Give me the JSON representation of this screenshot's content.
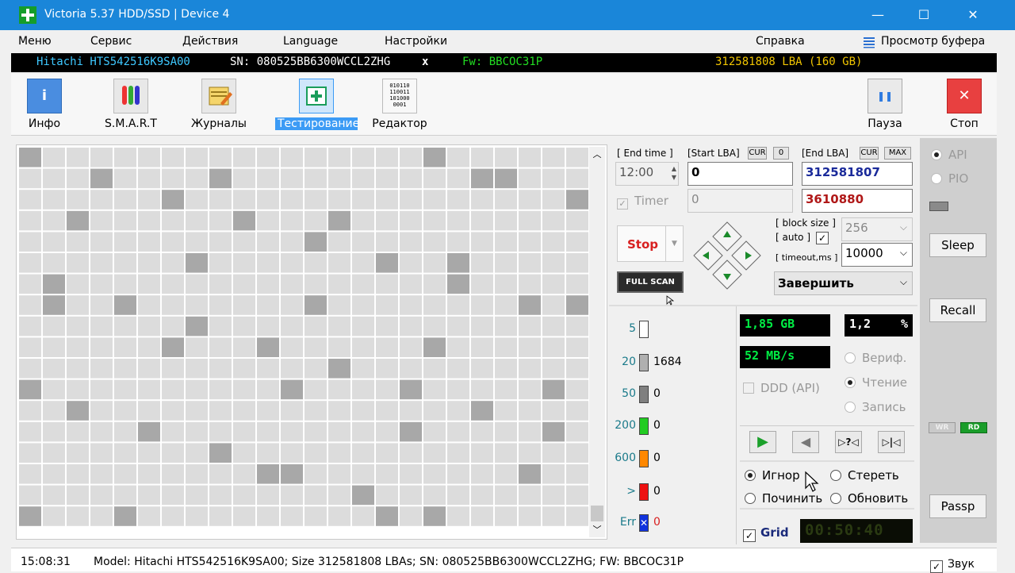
{
  "window": {
    "title": "Victoria 5.37 HDD/SSD | Device 4",
    "minimize": "—",
    "maximize": "☐",
    "close": "✕"
  },
  "menu": [
    "Меню",
    "Сервис",
    "Действия",
    "Language",
    "Настройки"
  ],
  "menu_right": {
    "help": "Справка",
    "buffer_icon": "list-icon",
    "buffer": "Просмотр буфера"
  },
  "device": {
    "model": "Hitachi HTS542516K9SA00",
    "sn": "SN: 080525BB6300WCCL2ZHG",
    "close": "x",
    "fw": "Fw: BBCOC31P",
    "lba": "312581808 LBA (160 GB)"
  },
  "toolbar": {
    "info": "Инфо",
    "smart": "S.M.A.R.T",
    "logs": "Журналы",
    "test": "Тестирование",
    "editor": "Редактор",
    "pause": "Пауза",
    "stop": "Стоп",
    "editor_icon_text": "010110\n110011\n101000\n0001"
  },
  "scan": {
    "end_time_label": "[ End time ]",
    "start_lba_label": "[Start LBA]",
    "cur1": "CUR",
    "zero": "0",
    "end_lba_label": "[End LBA]",
    "cur2": "CUR",
    "max": "MAX",
    "time_value": "12:00",
    "start_lba_value": "0",
    "end_lba_value": "312581807",
    "timer_label": "Timer",
    "timer_value": "0",
    "current_lba": "3610880",
    "stop_label": "Stop",
    "full_scan": "FULL SCAN",
    "block_size_label": "[ block size ]",
    "auto_label": "[ auto ]",
    "block_size_value": "256",
    "timeout_label": "[ timeout,ms ]",
    "timeout_value": "10000",
    "finish_action": "Завершить"
  },
  "levels": [
    {
      "label": "5",
      "count": "",
      "color": "#ffffff"
    },
    {
      "label": "20",
      "count": "1684",
      "color": "#b0b0b0"
    },
    {
      "label": "50",
      "count": "0",
      "color": "#808080"
    },
    {
      "label": "200",
      "count": "0",
      "color": "#22cc22"
    },
    {
      "label": "600",
      "count": "0",
      "color": "#ff8800"
    },
    {
      "label": ">",
      "count": "0",
      "color": "#ee1111"
    },
    {
      "label": "Err",
      "count": "0",
      "color": "#1133dd"
    }
  ],
  "stats": {
    "size_read": "1,85 GB",
    "percent": "1,2",
    "percent_unit": "%",
    "speed": "52 MB/s",
    "ddd_label": "DDD (API)",
    "verify": "Вериф.",
    "read": "Чтение",
    "write": "Запись",
    "play": "▶",
    "back": "◀",
    "skip_q": "▷?◁",
    "skip": "▷|◁",
    "ignore": "Игнор",
    "erase": "Стереть",
    "repair": "Починить",
    "refresh": "Обновить",
    "grid_label": "Grid",
    "timer_display": "00:50:40"
  },
  "side": {
    "api": "API",
    "pio": "PIO",
    "sleep": "Sleep",
    "recall": "Recall",
    "wr": "WR",
    "rd": "RD",
    "passp": "Passp",
    "sound": "Звук"
  },
  "status": {
    "time": "15:08:31",
    "message": "Model: Hitachi HTS542516K9SA00; Size 312581808 LBAs; SN: 080525BB6300WCCL2ZHG; FW: BBCOC31P"
  },
  "colors": {
    "titlebar": "#1a86d9",
    "accent_selected": "#3c9bf5",
    "lcd_green": "#00ee44",
    "lcd_white": "#ffffff",
    "block_light": "#dcdcdc",
    "block_dark": "#a8a8a8"
  }
}
